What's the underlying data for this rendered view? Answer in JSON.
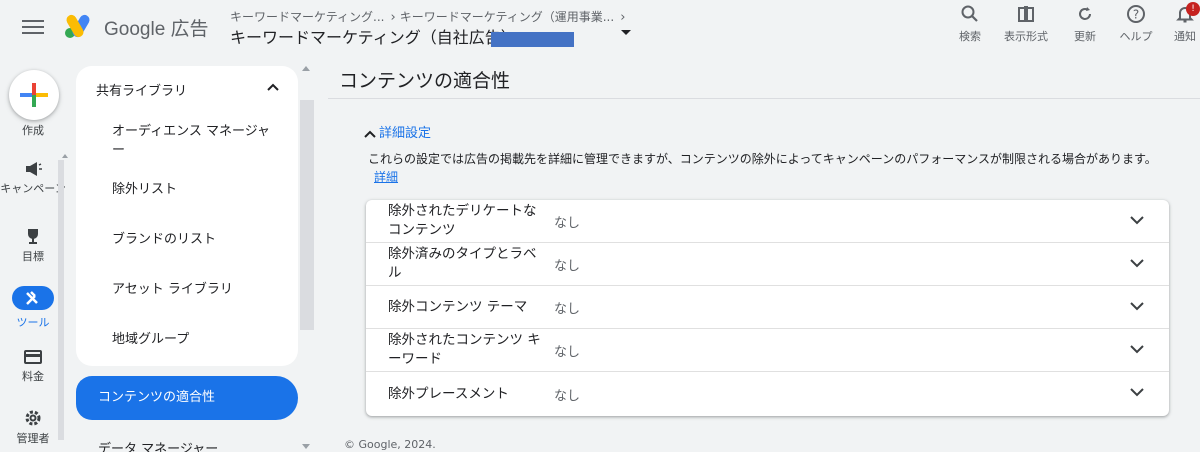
{
  "header": {
    "brand": "Google 広告",
    "breadcrumbs": [
      "キーワードマーケティング...",
      "キーワードマーケティング（運用事業..."
    ],
    "account_name": "キーワードマーケティング（自社広告）",
    "tools": {
      "search": "検索",
      "view_format": "表示形式",
      "refresh": "更新",
      "help": "ヘルプ",
      "notifications": "通知",
      "notifications_badge": "!"
    }
  },
  "rail": {
    "create": "作成",
    "campaigns": "キャンペーン",
    "goals": "目標",
    "tools": "ツール",
    "billing": "料金",
    "admin": "管理者"
  },
  "subnav": {
    "section": "共有ライブラリ",
    "items": [
      "オーディエンス マネージャー",
      "除外リスト",
      "ブランドのリスト",
      "アセット ライブラリ",
      "地域グループ"
    ],
    "active": "コンテンツの適合性",
    "next_section": "データ マネージャー"
  },
  "main": {
    "title": "コンテンツの適合性",
    "advanced_toggle": "詳細設定",
    "description": "これらの設定では広告の掲載先を詳細に管理できますが、コンテンツの除外によってキャンペーンのパフォーマンスが制限される場合があります。",
    "details_link": "詳細",
    "rows": [
      {
        "label": "除外されたデリケートなコンテンツ",
        "value": "なし"
      },
      {
        "label": "除外済みのタイプとラベル",
        "value": "なし"
      },
      {
        "label": "除外コンテンツ テーマ",
        "value": "なし"
      },
      {
        "label": "除外されたコンテンツ キーワード",
        "value": "なし"
      },
      {
        "label": "除外プレースメント",
        "value": "なし"
      }
    ]
  },
  "footer": "© Google, 2024.",
  "colors": {
    "accent": "#1a73e8",
    "background": "#f1f3f4",
    "redaction": "#4472c4"
  }
}
